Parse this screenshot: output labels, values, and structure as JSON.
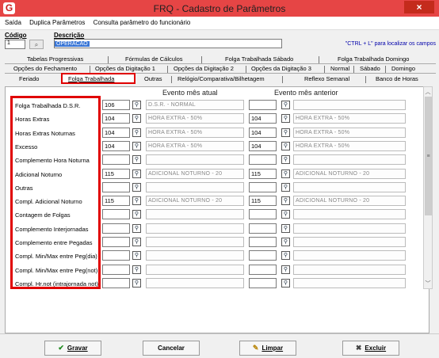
{
  "window": {
    "title": "FRQ - Cadastro de Parâmetros",
    "app_icon": "G",
    "close": "×"
  },
  "menu": [
    "Saída",
    "Duplica Parâmetros",
    "Consulta parâmetro do funcionário"
  ],
  "header": {
    "codigo_label": "Código",
    "codigo_value": "1",
    "descricao_label": "Descrição",
    "descricao_value": "OPERACAO",
    "hint": "\"CTRL + L\" para localizar os campos"
  },
  "tabs": {
    "row1": [
      "Tabelas Progressivas",
      "Fórmulas de Cálculos",
      "Folga Trabalhada Sábado",
      "Folga Trabalhada Domingo"
    ],
    "row2": [
      "Opções do Fechamento",
      "Opções da Digitação 1",
      "Opções da Digitação 2",
      "Opções da Digitação 3",
      "Normal",
      "Sábado",
      "Domingo"
    ],
    "row3": [
      "Feriado",
      "Folga Trabalhada",
      "Outras",
      "Relógio/Comparativa/Bilhetagem",
      "Reflexo Semanal",
      "Banco de Horas"
    ],
    "active": "Folga Trabalhada"
  },
  "columns": {
    "current": "Evento mês atual",
    "previous": "Evento mês anterior"
  },
  "rows": [
    {
      "label": "Folga Trabalhada D.S.R.",
      "cur_code": "106",
      "cur_desc": "D.S.R. - NORMAL",
      "prev_code": "",
      "prev_desc": ""
    },
    {
      "label": "Horas Extras",
      "cur_code": "104",
      "cur_desc": "HORA EXTRA - 50%",
      "prev_code": "104",
      "prev_desc": "HORA EXTRA - 50%"
    },
    {
      "label": "Horas Extras Noturnas",
      "cur_code": "104",
      "cur_desc": "HORA EXTRA - 50%",
      "prev_code": "104",
      "prev_desc": "HORA EXTRA - 50%"
    },
    {
      "label": "Excesso",
      "cur_code": "104",
      "cur_desc": "HORA EXTRA - 50%",
      "prev_code": "104",
      "prev_desc": "HORA EXTRA - 50%"
    },
    {
      "label": "Complemento Hora Noturna",
      "cur_code": "",
      "cur_desc": "",
      "prev_code": "",
      "prev_desc": ""
    },
    {
      "label": "Adicional Noturno",
      "cur_code": "115",
      "cur_desc": "ADICIONAL NOTURNO - 20",
      "prev_code": "115",
      "prev_desc": "ADICIONAL NOTURNO - 20"
    },
    {
      "label": "Outras",
      "cur_code": "",
      "cur_desc": "",
      "prev_code": "",
      "prev_desc": ""
    },
    {
      "label": "Compl. Adicional Noturno",
      "cur_code": "115",
      "cur_desc": "ADICIONAL NOTURNO - 20",
      "prev_code": "115",
      "prev_desc": "ADICIONAL NOTURNO - 20"
    },
    {
      "label": "Contagem de Folgas",
      "cur_code": "",
      "cur_desc": "",
      "prev_code": "",
      "prev_desc": ""
    },
    {
      "label": "Complemento Interjornadas",
      "cur_code": "",
      "cur_desc": "",
      "prev_code": "",
      "prev_desc": ""
    },
    {
      "label": "Complemento entre Pegadas",
      "cur_code": "",
      "cur_desc": "",
      "prev_code": "",
      "prev_desc": ""
    },
    {
      "label": "Compl. Min/Max entre Peg(dia)",
      "cur_code": "",
      "cur_desc": "",
      "prev_code": "",
      "prev_desc": ""
    },
    {
      "label": "Compl. Min/Max entre Peg(not)",
      "cur_code": "",
      "cur_desc": "",
      "prev_code": "",
      "prev_desc": ""
    },
    {
      "label": "Compl. Hr.not (intrajornada not)",
      "cur_code": "",
      "cur_desc": "",
      "prev_code": "",
      "prev_desc": ""
    }
  ],
  "buttons": {
    "save": "Gravar",
    "cancel": "Cancelar",
    "clear": "Limpar",
    "delete": "Excluir"
  },
  "colors": {
    "title_bar": "#e64545",
    "highlight": "#e00000",
    "selection": "#3a76d6"
  }
}
